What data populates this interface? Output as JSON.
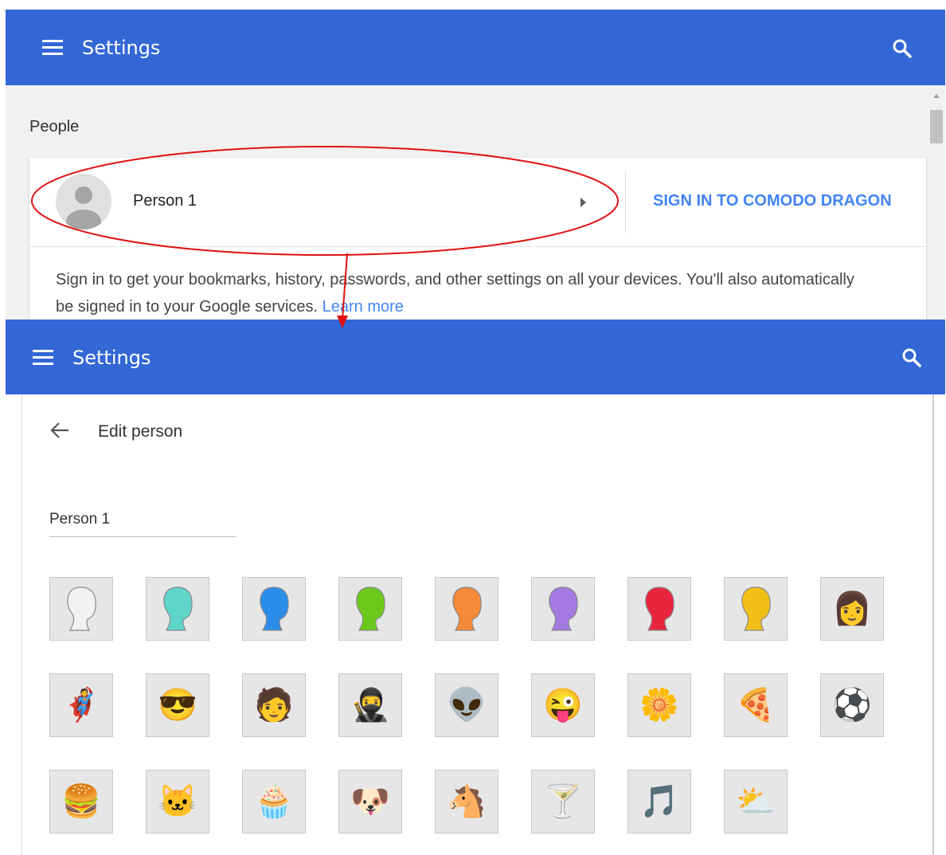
{
  "top_window": {
    "title": "Settings",
    "section_label": "People",
    "person_name": "Person 1",
    "sign_in_button": "SIGN IN TO COMODO DRAGON",
    "description": "Sign in to get your bookmarks, history, passwords, and other settings on all your devices. You'll also automatically be signed in to your Google services. ",
    "learn_more": "Learn more"
  },
  "bottom_window": {
    "title": "Settings",
    "page_heading": "Edit person",
    "name_field_value": "Person 1"
  },
  "colors": {
    "header_blue": "#3367d6",
    "link_blue": "#4285f4",
    "annotation_red": "#e01010"
  },
  "avatars": [
    {
      "name": "avatar-white-head-icon",
      "kind": "head",
      "color": "#f2f2f2"
    },
    {
      "name": "avatar-teal-head-icon",
      "kind": "head",
      "color": "#5fd4c8"
    },
    {
      "name": "avatar-blue-head-icon",
      "kind": "head",
      "color": "#2a8ee8"
    },
    {
      "name": "avatar-green-head-icon",
      "kind": "head",
      "color": "#6cc91c"
    },
    {
      "name": "avatar-orange-head-icon",
      "kind": "head",
      "color": "#f5893a"
    },
    {
      "name": "avatar-purple-head-icon",
      "kind": "head",
      "color": "#a37ae0"
    },
    {
      "name": "avatar-red-head-icon",
      "kind": "head",
      "color": "#e8253f"
    },
    {
      "name": "avatar-yellow-head-icon",
      "kind": "head",
      "color": "#f2bf16"
    },
    {
      "name": "avatar-businesswoman-icon",
      "kind": "glyph",
      "glyph": "👩"
    },
    {
      "name": "avatar-superhero-icon",
      "kind": "glyph",
      "glyph": "🦸"
    },
    {
      "name": "avatar-woman-sunglasses-icon",
      "kind": "glyph",
      "glyph": "😎"
    },
    {
      "name": "avatar-businessman-icon",
      "kind": "glyph",
      "glyph": "🧑"
    },
    {
      "name": "avatar-ninja-icon",
      "kind": "glyph",
      "glyph": "🥷"
    },
    {
      "name": "avatar-alien-icon",
      "kind": "glyph",
      "glyph": "👽"
    },
    {
      "name": "avatar-smiley-icon",
      "kind": "glyph",
      "glyph": "😜"
    },
    {
      "name": "avatar-flower-icon",
      "kind": "glyph",
      "glyph": "🌼"
    },
    {
      "name": "avatar-pizza-icon",
      "kind": "glyph",
      "glyph": "🍕"
    },
    {
      "name": "avatar-soccer-ball-icon",
      "kind": "glyph",
      "glyph": "⚽"
    },
    {
      "name": "avatar-burger-icon",
      "kind": "glyph",
      "glyph": "🍔"
    },
    {
      "name": "avatar-cat-icon",
      "kind": "glyph",
      "glyph": "🐱"
    },
    {
      "name": "avatar-cupcake-icon",
      "kind": "glyph",
      "glyph": "🧁"
    },
    {
      "name": "avatar-dog-icon",
      "kind": "glyph",
      "glyph": "🐶"
    },
    {
      "name": "avatar-horse-icon",
      "kind": "glyph",
      "glyph": "🐴"
    },
    {
      "name": "avatar-cocktail-icon",
      "kind": "glyph",
      "glyph": "🍸"
    },
    {
      "name": "avatar-music-note-icon",
      "kind": "glyph",
      "glyph": "🎵"
    },
    {
      "name": "avatar-sun-cloud-icon",
      "kind": "glyph",
      "glyph": "⛅"
    }
  ]
}
